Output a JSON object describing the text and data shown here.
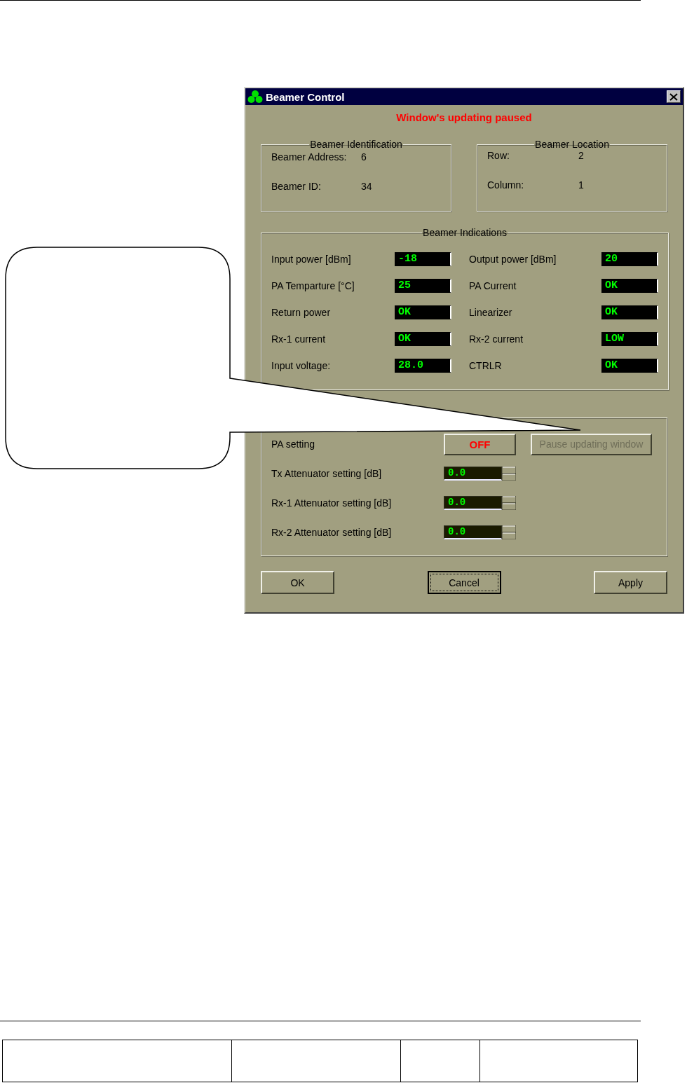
{
  "window": {
    "title": "Beamer Control",
    "status_message": "Window's updating paused"
  },
  "identification": {
    "title": "Beamer Identification",
    "fields": [
      {
        "label": "Beamer Address:",
        "value": "6"
      },
      {
        "label": "Beamer ID:",
        "value": "34"
      }
    ]
  },
  "location": {
    "title": "Beamer Location",
    "fields": [
      {
        "label": "Row:",
        "value": "2"
      },
      {
        "label": "Column:",
        "value": "1"
      }
    ]
  },
  "indications": {
    "title": "Beamer Indications",
    "items": [
      {
        "label": "Input power [dBm]",
        "value": "-18"
      },
      {
        "label": "Output power [dBm]",
        "value": "20"
      },
      {
        "label": "PA Temparture [°C]",
        "value": "25"
      },
      {
        "label": "PA Current",
        "value": "OK"
      },
      {
        "label": "Return power",
        "value": "OK"
      },
      {
        "label": "Linearizer",
        "value": "OK"
      },
      {
        "label": "Rx-1 current",
        "value": "OK"
      },
      {
        "label": "Rx-2 current",
        "value": "LOW"
      },
      {
        "label": "Input voltage:",
        "value": "28.0"
      },
      {
        "label": "CTRLR",
        "value": "OK"
      }
    ]
  },
  "setting": {
    "rows": [
      {
        "kind": "toggle",
        "label": "PA setting",
        "button": "OFF",
        "secondary": {
          "label": "Pause updating window",
          "disabled": true
        }
      },
      {
        "kind": "spin",
        "label": "Tx Attenuator setting [dB]",
        "value": "0.0"
      },
      {
        "kind": "spin",
        "label": "Rx-1 Attenuator setting [dB]",
        "value": "0.0"
      },
      {
        "kind": "spin",
        "label": "Rx-2 Attenuator setting [dB]",
        "value": "0.0"
      }
    ]
  },
  "buttons": [
    {
      "label": "OK",
      "focused": false
    },
    {
      "label": "Cancel",
      "focused": true
    },
    {
      "label": "Apply",
      "focused": false
    }
  ]
}
